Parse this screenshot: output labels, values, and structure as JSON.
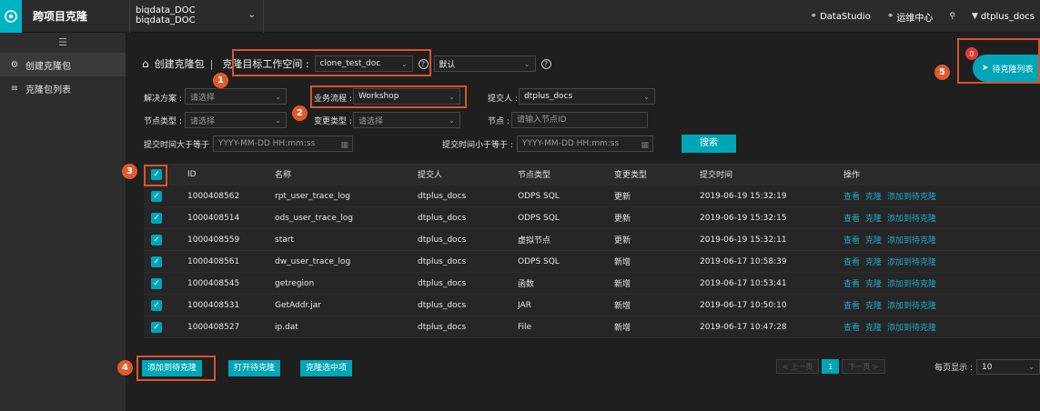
{
  "topbar": {
    "title": "跨项目克隆",
    "project_line1": "biqdata_DOC",
    "project_line2": "biqdata_DOC",
    "links": [
      {
        "icon": "link-icon",
        "label": "DataStudio"
      },
      {
        "icon": "link-icon",
        "label": "运维中心"
      }
    ],
    "user": "dtplus_docs"
  },
  "sidebar": {
    "items": [
      {
        "icon": "clone-icon",
        "label": "创建克隆包",
        "active": true
      },
      {
        "icon": "list-icon",
        "label": "克隆包列表",
        "active": false
      }
    ]
  },
  "header": {
    "title": "创建克隆包",
    "separator": "|",
    "ws_label": "克隆目标工作空间 :",
    "ws_value": "clone_test_doc",
    "default_value": "默认"
  },
  "filters": {
    "solution_label": "解决方案 :",
    "solution_placeholder": "请选择",
    "flow_label": "业务流程 :",
    "flow_value": "Workshop",
    "submitter_label": "提交人 :",
    "submitter_value": "dtplus_docs",
    "node_type_label": "节点类型 :",
    "node_type_placeholder": "请选择",
    "change_type_label": "变更类型 :",
    "change_type_placeholder": "请选择",
    "node_label": "节点 :",
    "node_placeholder": "请输入节点ID",
    "time_ge_label": "提交时间大于等于 :",
    "time_ge_placeholder": "YYYY-MM-DD HH:mm:ss",
    "time_le_label": "提交时间小于等于 :",
    "time_le_placeholder": "YYYY-MM-DD HH:mm:ss",
    "search_label": "搜索"
  },
  "table": {
    "headers": [
      "ID",
      "名称",
      "提交人",
      "节点类型",
      "变更类型",
      "提交时间",
      "操作"
    ],
    "ops": [
      "查看",
      "克隆",
      "添加到待克隆"
    ],
    "rows": [
      {
        "id": "1000408562",
        "name": "rpt_user_trace_log",
        "submitter": "dtplus_docs",
        "node_type": "ODPS SQL",
        "change": "更新",
        "time": "2019-06-19 15:32:19"
      },
      {
        "id": "1000408514",
        "name": "ods_user_trace_log",
        "submitter": "dtplus_docs",
        "node_type": "ODPS SQL",
        "change": "更新",
        "time": "2019-06-19 15:32:15"
      },
      {
        "id": "1000408559",
        "name": "start",
        "submitter": "dtplus_docs",
        "node_type": "虚拟节点",
        "change": "更新",
        "time": "2019-06-19 15:32:11"
      },
      {
        "id": "1000408561",
        "name": "dw_user_trace_log",
        "submitter": "dtplus_docs",
        "node_type": "ODPS SQL",
        "change": "新增",
        "time": "2019-06-17 10:58:39"
      },
      {
        "id": "1000408545",
        "name": "getregion",
        "submitter": "dtplus_docs",
        "node_type": "函数",
        "change": "新增",
        "time": "2019-06-17 10:53:41"
      },
      {
        "id": "1000408531",
        "name": "GetAddr.jar",
        "submitter": "dtplus_docs",
        "node_type": "JAR",
        "change": "新增",
        "time": "2019-06-17 10:50:10"
      },
      {
        "id": "1000408527",
        "name": "ip.dat",
        "submitter": "dtplus_docs",
        "node_type": "File",
        "change": "新增",
        "time": "2019-06-17 10:47:28"
      }
    ]
  },
  "actions": {
    "add_pending": "添加到待克隆",
    "open_pending": "打开待克隆",
    "clone_selected": "克隆选中项"
  },
  "pagination": {
    "prev": "< 上一页",
    "current": "1",
    "next": "下一页 >",
    "per_page_label": "每页显示 :",
    "per_page_value": "10"
  },
  "pending": {
    "label": "待克隆列表",
    "count": "0"
  },
  "markers": [
    "1",
    "2",
    "3",
    "4",
    "5"
  ],
  "colors": {
    "accent": "#00a5b8",
    "marker": "#e05a2b",
    "highlight_box": "#d9532e",
    "link": "#1fa8c9"
  }
}
